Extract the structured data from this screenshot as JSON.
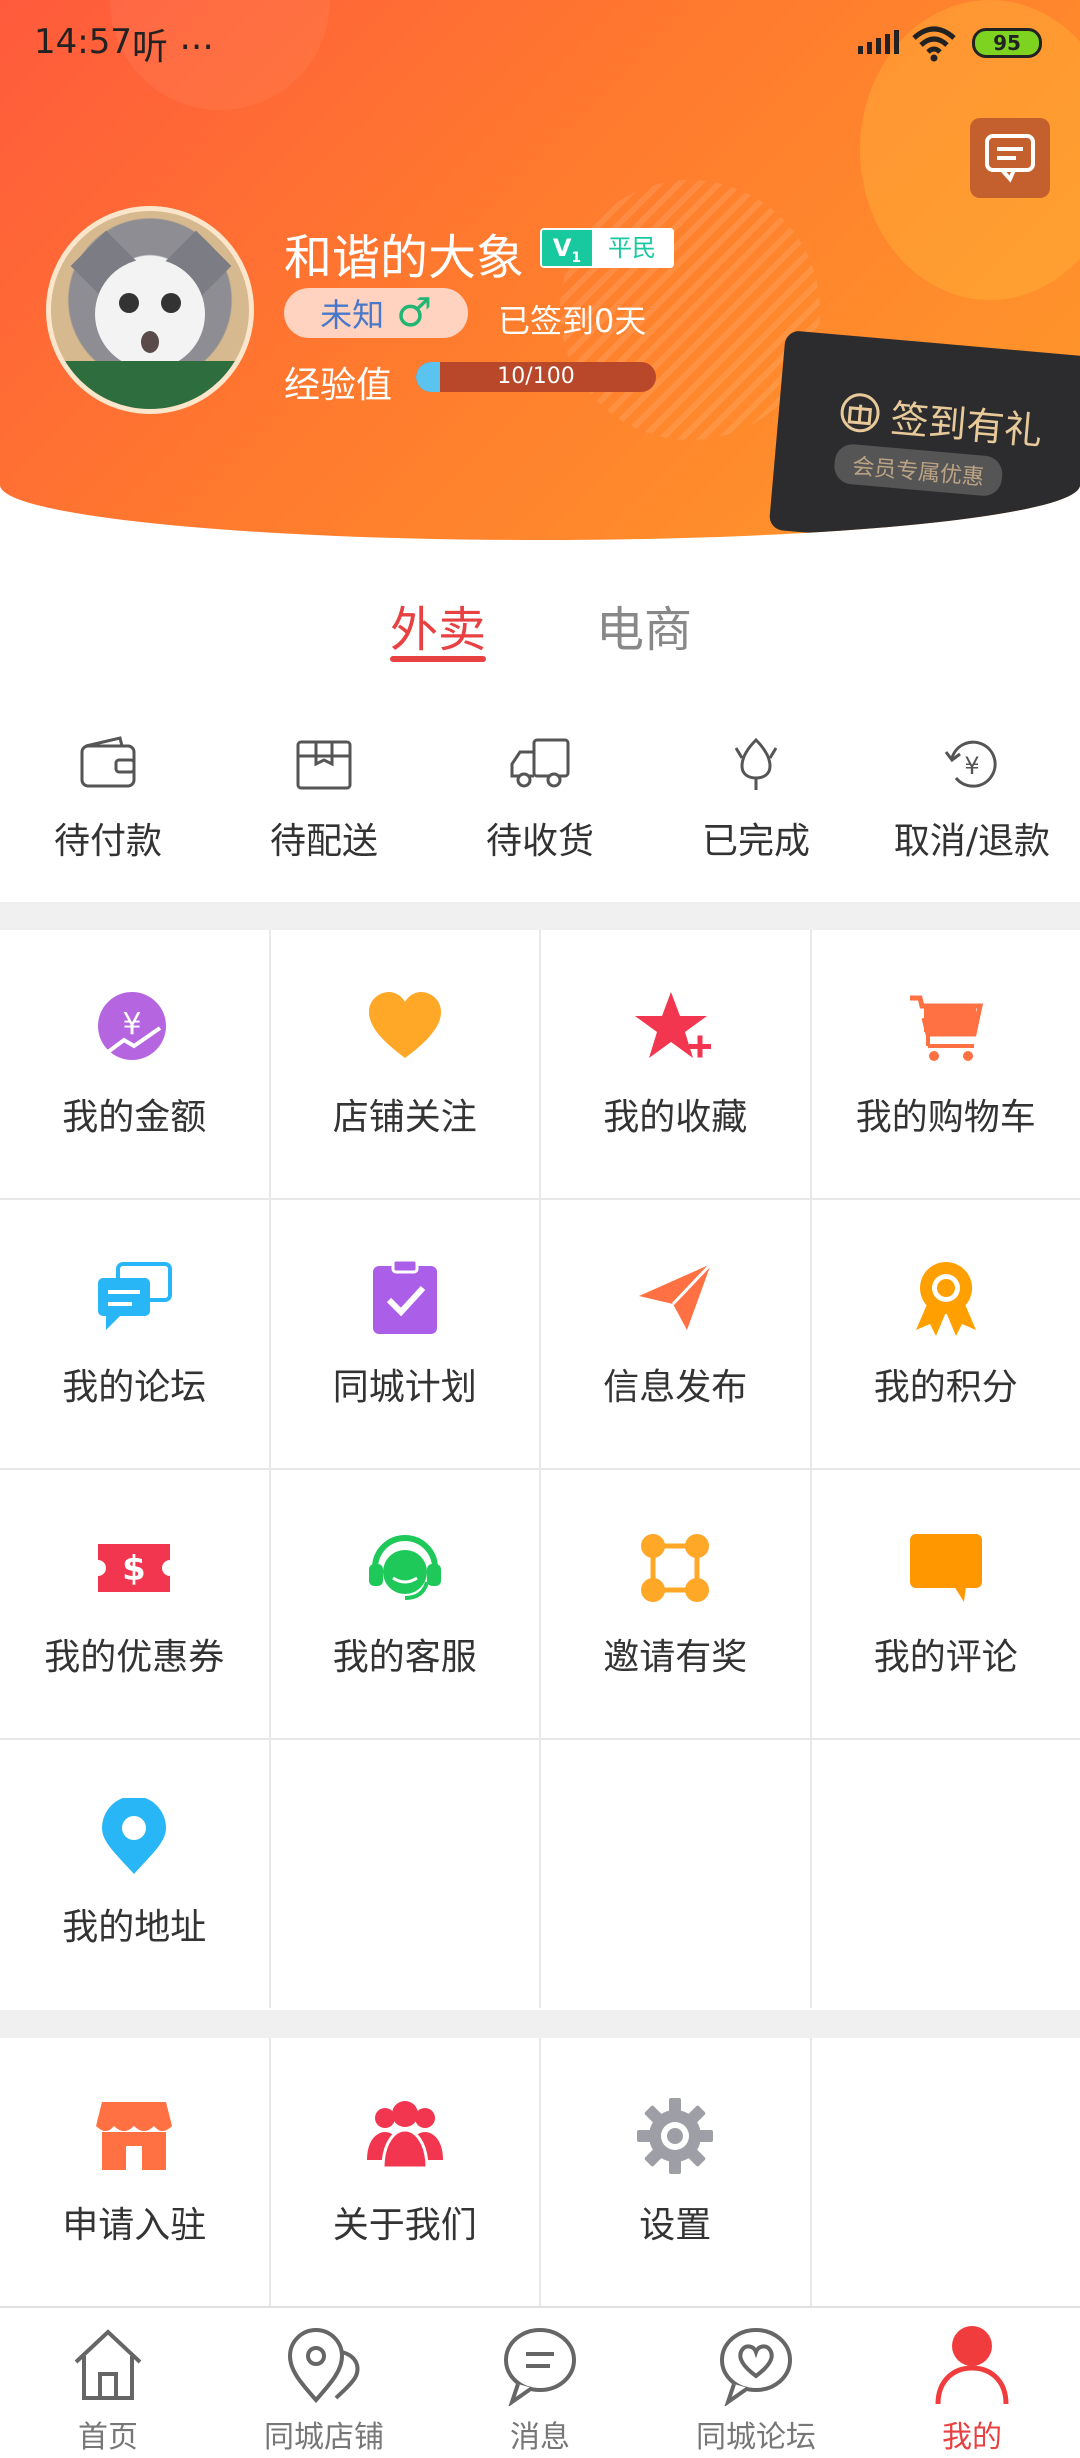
{
  "status_bar": {
    "time": "14:57",
    "extra": "听 ···",
    "battery": "95"
  },
  "profile": {
    "name": "和谐的大象",
    "vip_level": "V",
    "vip_sub": "1",
    "rank": "平民",
    "gender_text": "未知",
    "gender_symbol": "♂",
    "signin_text": "已签到0天",
    "exp_label": "经验值",
    "exp_text": "10/100",
    "exp_progress": 0.1,
    "signin_card_title": "签到有礼",
    "signin_card_sub": "会员专属优惠"
  },
  "tabs": [
    {
      "label": "外卖",
      "active": true
    },
    {
      "label": "电商",
      "active": false
    }
  ],
  "orders": [
    {
      "label": "待付款",
      "icon": "wallet-icon"
    },
    {
      "label": "待配送",
      "icon": "box-icon"
    },
    {
      "label": "待收货",
      "icon": "truck-icon"
    },
    {
      "label": "已完成",
      "icon": "flower-icon"
    },
    {
      "label": "取消/退款",
      "icon": "refund-icon"
    }
  ],
  "features": [
    {
      "label": "我的金额",
      "icon": "money-icon",
      "color": "#b565e0"
    },
    {
      "label": "店铺关注",
      "icon": "heart-icon",
      "color": "#ffa726"
    },
    {
      "label": "我的收藏",
      "icon": "star-icon",
      "color": "#f2364f"
    },
    {
      "label": "我的购物车",
      "icon": "cart-icon",
      "color": "#ff7043"
    },
    {
      "label": "我的论坛",
      "icon": "chat-icon",
      "color": "#29b6f6"
    },
    {
      "label": "同城计划",
      "icon": "clipboard-icon",
      "color": "#ab5ee8"
    },
    {
      "label": "信息发布",
      "icon": "send-icon",
      "color": "#ff7043"
    },
    {
      "label": "我的积分",
      "icon": "medal-icon",
      "color": "#ffa000"
    },
    {
      "label": "我的优惠券",
      "icon": "coupon-icon",
      "color": "#f2364f"
    },
    {
      "label": "我的客服",
      "icon": "headset-icon",
      "color": "#1ec95a"
    },
    {
      "label": "邀请有奖",
      "icon": "network-icon",
      "color": "#ffa726"
    },
    {
      "label": "我的评论",
      "icon": "comment-icon",
      "color": "#ff9800"
    },
    {
      "label": "我的地址",
      "icon": "location-icon",
      "color": "#29b6f6"
    }
  ],
  "others": [
    {
      "label": "申请入驻",
      "icon": "shop-icon",
      "color": "#ff7043"
    },
    {
      "label": "关于我们",
      "icon": "group-icon",
      "color": "#f2364f"
    },
    {
      "label": "设置",
      "icon": "gear-icon",
      "color": "#9e9ea6"
    }
  ],
  "bottom_nav": [
    {
      "label": "首页",
      "icon": "home-icon",
      "active": false
    },
    {
      "label": "同城店铺",
      "icon": "map-pin-icon",
      "active": false
    },
    {
      "label": "消息",
      "icon": "message-icon",
      "active": false
    },
    {
      "label": "同城论坛",
      "icon": "forum-heart-icon",
      "active": false
    },
    {
      "label": "我的",
      "icon": "user-icon",
      "active": true
    }
  ],
  "colors": {
    "accent": "#e84142",
    "header_start": "#ff5a3c",
    "header_end": "#ff9a2a"
  }
}
